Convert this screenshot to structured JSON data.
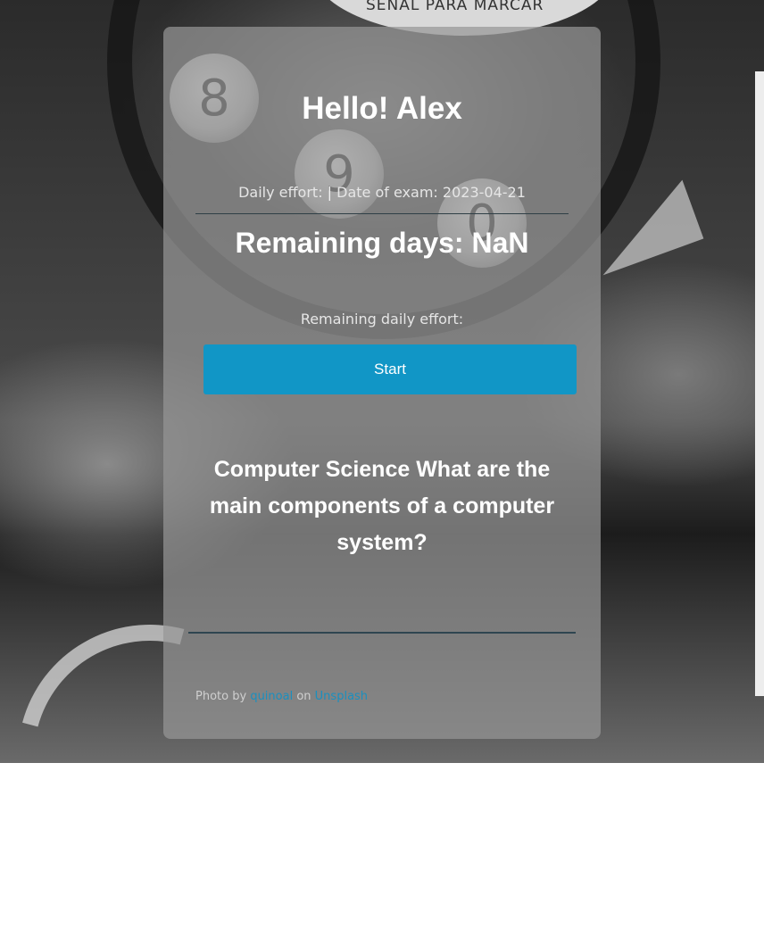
{
  "background": {
    "dial_text": "SEÑAL PARA MARCAR",
    "dial_digits": [
      "8",
      "9",
      "0"
    ]
  },
  "header": {
    "greeting": "Hello! Alex"
  },
  "status": {
    "daily_effort_label": "Daily effort:",
    "separator": "|",
    "exam_date_label": "Date of exam:",
    "exam_date_value": "2023-04-21",
    "remaining_days": "Remaining days: NaN",
    "remaining_daily_effort": "Remaining daily effort:"
  },
  "actions": {
    "start_label": "Start"
  },
  "question": {
    "text": "Computer Science What are the main components of a computer system?",
    "answer_value": ""
  },
  "credit": {
    "prefix": "Photo by",
    "author": "quinoal",
    "middle": "on",
    "site": "Unsplash"
  },
  "colors": {
    "accent": "#1196c6",
    "card_overlay": "#969696",
    "link": "#1a8fbf"
  }
}
